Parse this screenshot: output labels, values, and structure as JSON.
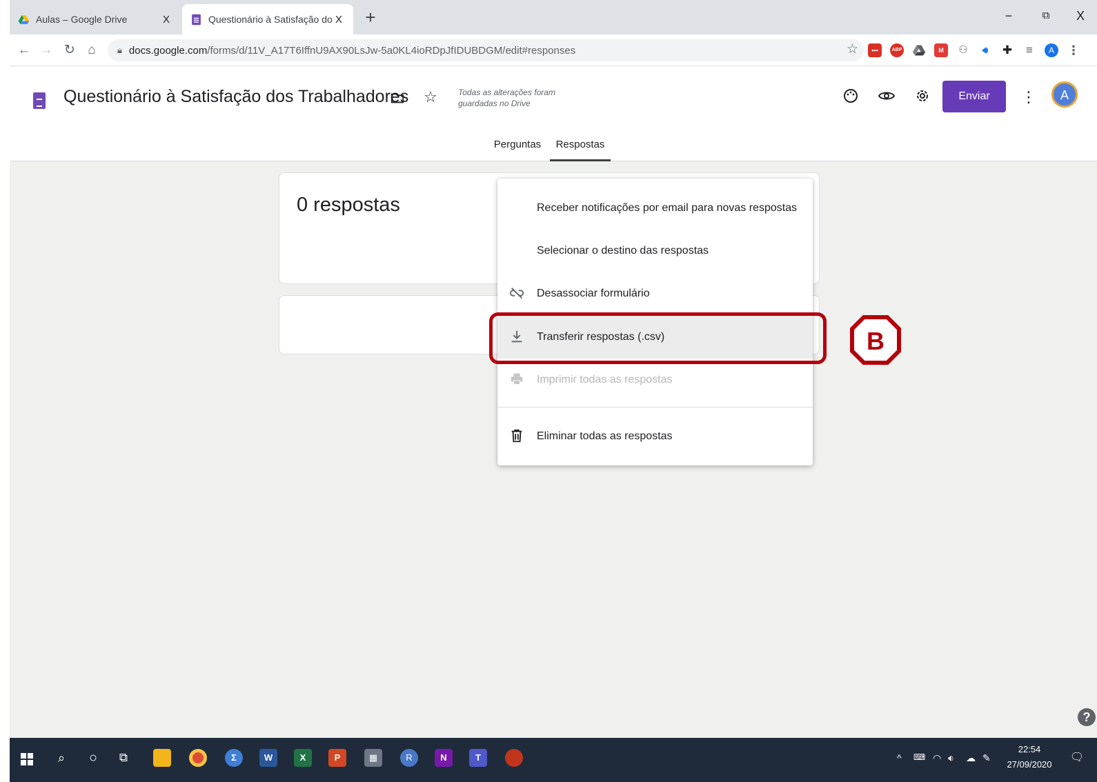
{
  "browser": {
    "tabs": [
      {
        "title": "Aulas – Google Drive",
        "close": "X"
      },
      {
        "title": "Questionário à Satisfação dos Tra",
        "close": "X"
      }
    ],
    "new_tab": "+",
    "window_controls": {
      "minimize": "−",
      "restore": "⧉",
      "close": "X"
    },
    "url_host": "docs.google.com",
    "url_path": "/forms/d/11V_A17T6IffnU9AX90LsJw-5a0KL4ioRDpJfIDUBDGM/edit#responses",
    "profile_initial": "A",
    "extensions": [
      "ABP",
      "A"
    ]
  },
  "forms": {
    "title": "Questionário à Satisfação dos Trabalhadores",
    "saved_line1": "Todas as alterações foram",
    "saved_line2": "guardadas no Drive",
    "send_label": "Enviar",
    "avatar_initial": "A",
    "tabs": [
      "Perguntas",
      "Respostas"
    ],
    "active_tab": "Respostas"
  },
  "responses": {
    "count_label": "0 respostas"
  },
  "menu": {
    "items": [
      {
        "label": "Receber notificações por email para novas respostas",
        "icon": "none",
        "state": "enabled"
      },
      {
        "label": "Selecionar o destino das respostas",
        "icon": "none",
        "state": "enabled"
      },
      {
        "label": "Desassociar formulário",
        "icon": "unlink-icon",
        "state": "enabled"
      },
      {
        "label": "Transferir respostas (.csv)",
        "icon": "download-icon",
        "state": "hovered"
      },
      {
        "label": "Imprimir todas as respostas",
        "icon": "print-icon",
        "state": "disabled"
      },
      {
        "label": "Eliminar todas as respostas",
        "icon": "trash-icon",
        "state": "enabled"
      }
    ]
  },
  "annotation": {
    "marker_letter": "B",
    "color": "#b5000b"
  },
  "taskbar": {
    "time": "22:54",
    "date": "27/09/2020",
    "notification_count": "1"
  },
  "colors": {
    "accent": "#673ab7",
    "content_bg": "#f0f0ef",
    "taskbar_bg": "#1f2b3b"
  }
}
